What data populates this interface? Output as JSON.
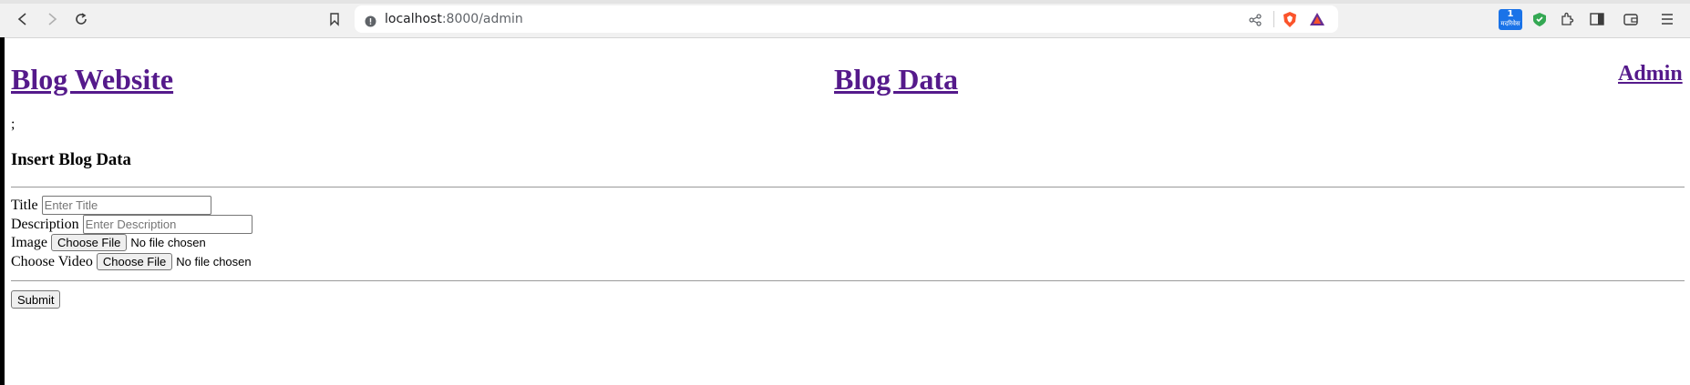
{
  "browser": {
    "url_host": "localhost",
    "url_rest": ":8000/admin",
    "icons": [
      "back-icon",
      "forward-icon",
      "reload-icon",
      "bookmark-icon",
      "site-info-icon",
      "share-icon",
      "brave-shields-icon",
      "brave-rewards-icon",
      "extension-badge-icon",
      "vpn-shield-icon",
      "extensions-icon",
      "sidebar-icon",
      "wallet-icon",
      "menu-icon"
    ],
    "badge_text": "1",
    "badge_subtext": "मदरिवेस"
  },
  "header": {
    "site_title": "Blog Website",
    "center_link": "Blog Data",
    "admin_link": "Admin"
  },
  "stray_text": ";",
  "form": {
    "heading": "Insert Blog Data",
    "title_label": "Title",
    "title_placeholder": "Enter Title",
    "description_label": "Description",
    "description_placeholder": "Enter Description",
    "image_label": "Image",
    "video_label": "Choose Video",
    "file_button": "Choose File",
    "no_file": "No file chosen",
    "submit": "Submit"
  }
}
